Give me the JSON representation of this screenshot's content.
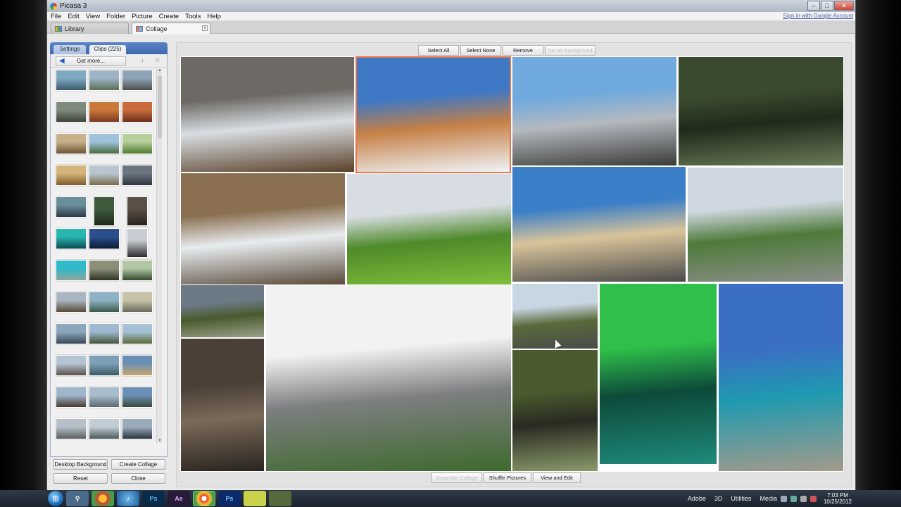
{
  "window": {
    "title": "Picasa 3",
    "controls": [
      "–",
      "□",
      "✕"
    ],
    "signin": "Sign in with Google Account"
  },
  "menu": [
    "File",
    "Edit",
    "View",
    "Folder",
    "Picture",
    "Create",
    "Tools",
    "Help"
  ],
  "top_tabs": {
    "library": "Library",
    "collage": "Collage"
  },
  "left_panel": {
    "tab_settings": "Settings",
    "tab_clips": "Clips (225)",
    "get_more": "Get more...",
    "add_symbol": "+",
    "close_symbol": "✕",
    "thumbnails": [
      {
        "c1": "#7fa9c0",
        "c2": "#3b5a6c"
      },
      {
        "c1": "#9db3c6",
        "c2": "#5b6e55"
      },
      {
        "c1": "#8ea3b6",
        "c2": "#4a4f4a"
      },
      {
        "c1": "#7f8a7e",
        "c2": "#3f4338"
      },
      {
        "c1": "#c9793a",
        "c2": "#7a3a20"
      },
      {
        "c1": "#c96b3d",
        "c2": "#6b2e1a"
      },
      {
        "c1": "#c7b08a",
        "c2": "#6a5535"
      },
      {
        "c1": "#9fc3dc",
        "c2": "#4b6a3b"
      },
      {
        "c1": "#b7cf9a",
        "c2": "#4e7a2e"
      },
      {
        "c1": "#d4b47a",
        "c2": "#7d5a2a"
      },
      {
        "c1": "#b8c5cf",
        "c2": "#7a6a4a"
      },
      {
        "c1": "#6a7580",
        "c2": "#2e3440"
      },
      {
        "c1": "#6a8f9a",
        "c2": "#2b3b45"
      },
      {
        "c1": "#3f5a3a",
        "c2": "#1b2a1c"
      },
      {
        "c1": "#5a5045",
        "c2": "#2a241e"
      },
      {
        "c1": "#27b6b0",
        "c2": "#0d4a55"
      },
      {
        "c1": "#2a4f8c",
        "c2": "#0e1b35"
      },
      {
        "c1": "#c8ccd2",
        "c2": "#2d2d2d"
      },
      {
        "c1": "#2fb9c9",
        "c2": "#8fa69a"
      },
      {
        "c1": "#8b8f78",
        "c2": "#2f3525"
      },
      {
        "c1": "#b1c7a4",
        "c2": "#2f4a2a"
      },
      {
        "c1": "#a9b6c2",
        "c2": "#5a4a3a"
      },
      {
        "c1": "#8fb3c6",
        "c2": "#3b5a4a"
      },
      {
        "c1": "#c8c2a8",
        "c2": "#6a6a5a"
      },
      {
        "c1": "#8ca7bb",
        "c2": "#3a4858"
      },
      {
        "c1": "#9eb8cf",
        "c2": "#44553a"
      },
      {
        "c1": "#a6c1d6",
        "c2": "#5a6a3a"
      },
      {
        "c1": "#b4c4d2",
        "c2": "#5a5048"
      },
      {
        "c1": "#7ea0b6",
        "c2": "#3a5a65"
      },
      {
        "c1": "#6a8fb6",
        "c2": "#c9a66b"
      },
      {
        "c1": "#9fb5c9",
        "c2": "#4a3a30"
      },
      {
        "c1": "#a8bccc",
        "c2": "#5b6a72"
      },
      {
        "c1": "#6b8fb6",
        "c2": "#3a4a3a"
      },
      {
        "c1": "#b5c0c8",
        "c2": "#5a5e60"
      },
      {
        "c1": "#c1ccd5",
        "c2": "#4a5a5a"
      },
      {
        "c1": "#9aacbc",
        "c2": "#2a3440"
      }
    ],
    "buttons": {
      "desktop": "Desktop Background",
      "create": "Create Collage",
      "reset": "Reset",
      "close": "Close"
    }
  },
  "collage_toolbar": [
    "Select All",
    "Select None",
    "Remove",
    "Set as Background"
  ],
  "bottom_toolbar": [
    "Scramble Collage",
    "Shuffle Pictures",
    "View and Edit"
  ],
  "photos": [
    {
      "name": "snow-shelter",
      "c1": "#6d6a66",
      "c2": "#d9dee3",
      "c3": "#5a4028"
    },
    {
      "name": "garni-temple",
      "c1": "#3f78c4",
      "c2": "#c58046",
      "c3": "#f1f4f8"
    },
    {
      "name": "snowy-valley-sun",
      "c1": "#6fa9dd",
      "c2": "#b4b9bf",
      "c3": "#3b3b38"
    },
    {
      "name": "gorge-river",
      "c1": "#3a4a2e",
      "c2": "#1f2a1a",
      "c3": "#6a7a58"
    },
    {
      "name": "snow-cliff-road",
      "c1": "#8a7050",
      "c2": "#e8ecef",
      "c3": "#5a4a3a"
    },
    {
      "name": "green-hills",
      "c1": "#d8dde3",
      "c2": "#4e8a2a",
      "c3": "#7fbf3a"
    },
    {
      "name": "rocky-beach",
      "c1": "#3b7fc8",
      "c2": "#d9c49a",
      "c3": "#4a4a4a"
    },
    {
      "name": "waterfall-cliffs",
      "c1": "#cfd8e0",
      "c2": "#4f7a3a",
      "c3": "#8a8f8a"
    },
    {
      "name": "castle-hill",
      "c1": "#6b7a85",
      "c2": "#4a5a2e",
      "c3": "#9aa08a"
    },
    {
      "name": "slot-canyon",
      "c1": "#4a4038",
      "c2": "#7a6a58",
      "c3": "#2a2420"
    },
    {
      "name": "stone-forest",
      "c1": "#f2f2f2",
      "c2": "#7d7f80",
      "c3": "#3e6a2e"
    },
    {
      "name": "mountain-road",
      "c1": "#c8d6e4",
      "c2": "#5a6a3a",
      "c3": "#4a4a4a"
    },
    {
      "name": "watkins-glen",
      "c1": "#4a5a2e",
      "c2": "#2a2a22",
      "c3": "#8a9a6a"
    },
    {
      "name": "aurora",
      "c1": "#2fbf4a",
      "c2": "#0d4a3a",
      "c3": "#1f8a7a"
    },
    {
      "name": "hot-spring",
      "c1": "#3a6fc4",
      "c2": "#1f9ab0",
      "c3": "#a39a8a"
    }
  ],
  "taskbar": {
    "icons": [
      "Ps",
      "Ae",
      "Ps"
    ],
    "labels": [
      "Adobe",
      "3D",
      "Utilities",
      "Media"
    ],
    "time": "7:03 PM",
    "date": "10/25/2012"
  }
}
